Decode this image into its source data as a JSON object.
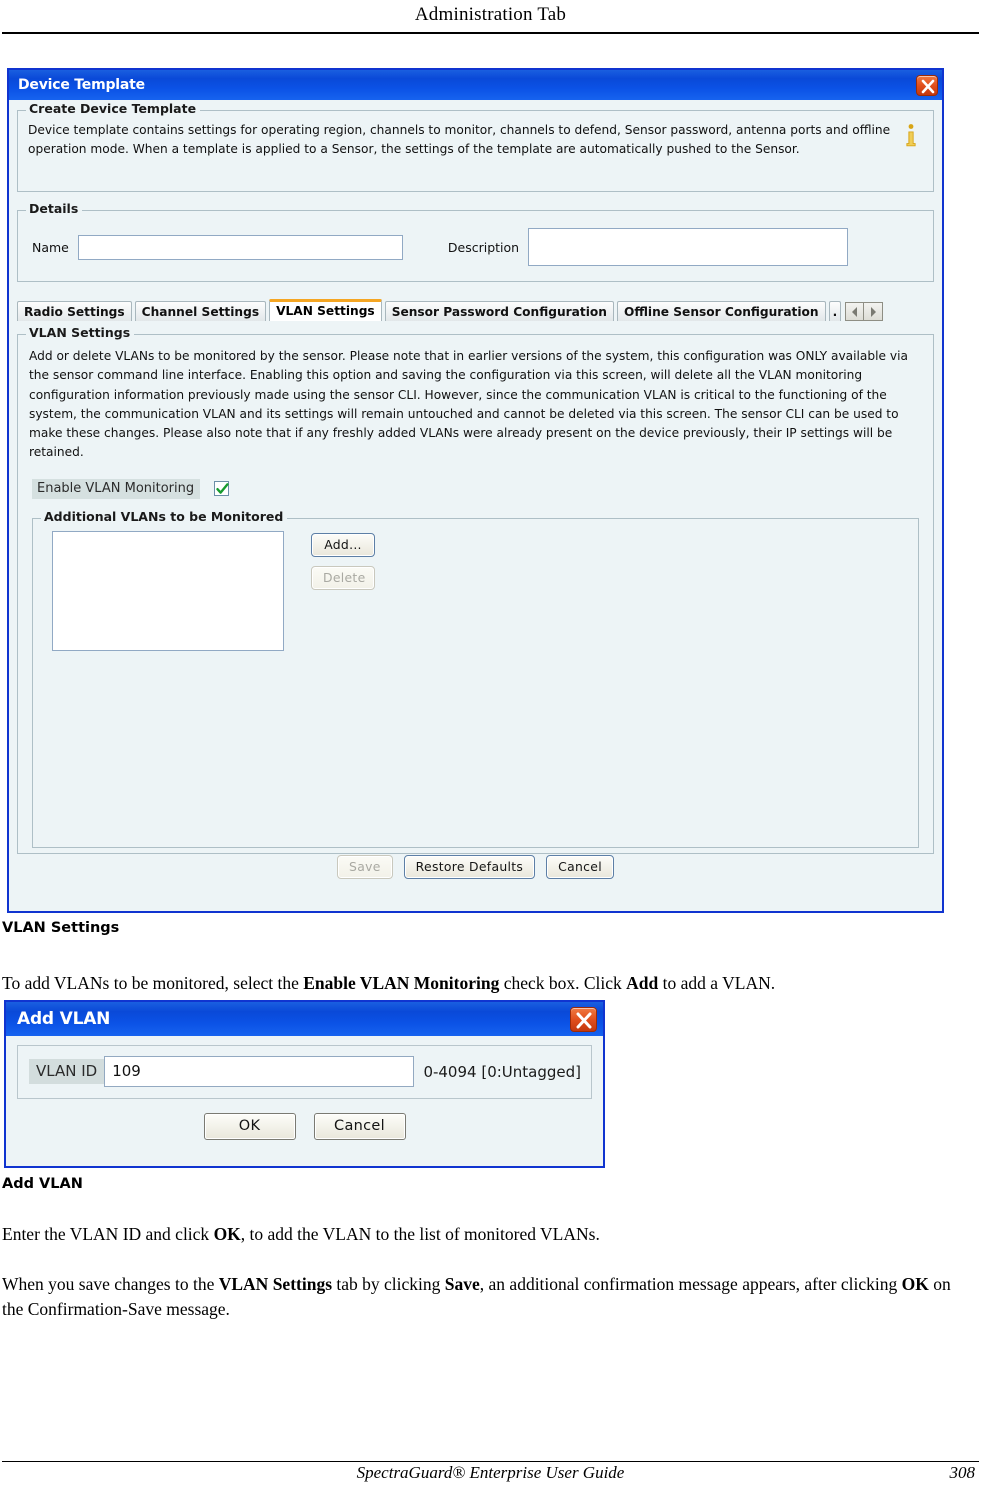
{
  "page": {
    "header_title": "Administration Tab",
    "footer_text": "SpectraGuard® Enterprise User Guide",
    "footer_page": "308"
  },
  "device_template_window": {
    "title": "Device Template",
    "close_icon": "close-icon",
    "create_group": {
      "legend": "Create Device Template",
      "description": "Device template contains settings for operating region, channels to monitor, channels to defend, Sensor password, antenna ports and offline operation mode. When a template is applied to a Sensor, the settings of the template are automatically pushed to the Sensor.",
      "info_icon": "info-icon"
    },
    "details_group": {
      "legend": "Details",
      "name_label": "Name",
      "name_value": "",
      "description_label": "Description",
      "description_value": ""
    },
    "tabs": [
      {
        "label": "Radio Settings",
        "active": false
      },
      {
        "label": "Channel Settings",
        "active": false
      },
      {
        "label": "VLAN Settings",
        "active": true
      },
      {
        "label": "Sensor Password Configuration",
        "active": false
      },
      {
        "label": "Offline Sensor Configuration",
        "active": false
      },
      {
        "label": ".",
        "active": false
      }
    ],
    "tab_scroll": {
      "left_icon": "chevron-left-icon",
      "right_icon": "chevron-right-icon"
    },
    "vlan_settings": {
      "legend": "VLAN Settings",
      "description": "Add or delete VLANs to be monitored by the sensor. Please note that in earlier versions of the system, this configuration was ONLY available via the sensor command line interface. Enabling this option and saving the configuration via this screen, will delete all the VLAN monitoring configuration information previously made using the sensor CLI. However, since the communication VLAN is critical to the functioning of the system, the communication VLAN and its settings will remain untouched and cannot be deleted via this screen. The sensor CLI can be used to make these changes. Please also note that if any freshly added VLANs were already present on the device previously, their IP settings will be retained.",
      "enable_label": "Enable VLAN Monitoring",
      "enable_checked": true,
      "check_icon": "check-icon",
      "additional_group_legend": "Additional VLANs to be Monitored",
      "vlan_list_items": [],
      "add_button": "Add...",
      "delete_button": "Delete"
    },
    "footer_buttons": {
      "save": "Save",
      "restore_defaults": "Restore Defaults",
      "cancel": "Cancel"
    }
  },
  "add_vlan_window": {
    "title": "Add VLAN",
    "close_icon": "close-icon",
    "vlan_id_label": "VLAN ID",
    "vlan_id_value": "109",
    "range_hint": "0-4094 [0:Untagged]",
    "ok_button": "OK",
    "cancel_button": "Cancel"
  },
  "captions": {
    "vlan_settings": "VLAN Settings",
    "add_vlan": "Add VLAN"
  },
  "body_text": {
    "para_1_a": "To add VLANs to be monitored, select the ",
    "para_1_b": "Enable VLAN Monitoring",
    "para_1_c": " check box. Click ",
    "para_1_d": "Add",
    "para_1_e": "  to add a VLAN.",
    "para_2_a": " Enter the VLAN ID and click ",
    "para_2_b": "OK",
    "para_2_c": ", to add the VLAN to the list of monitored VLANs.",
    "para_3_a": "When you save changes to the ",
    "para_3_b": "VLAN Settings",
    "para_3_c": " tab by clicking ",
    "para_3_d": "Save",
    "para_3_e": ", an additional confirmation message appears, after clicking ",
    "para_3_f": "OK",
    "para_3_g": " on the Confirmation-Save message."
  },
  "colors": {
    "titlebar_blue": "#0b49d8",
    "window_border": "#1034d0",
    "panel_bg": "#edf4f6",
    "active_tab_accent": "#f5a623",
    "close_button_red": "#e14f1c"
  }
}
